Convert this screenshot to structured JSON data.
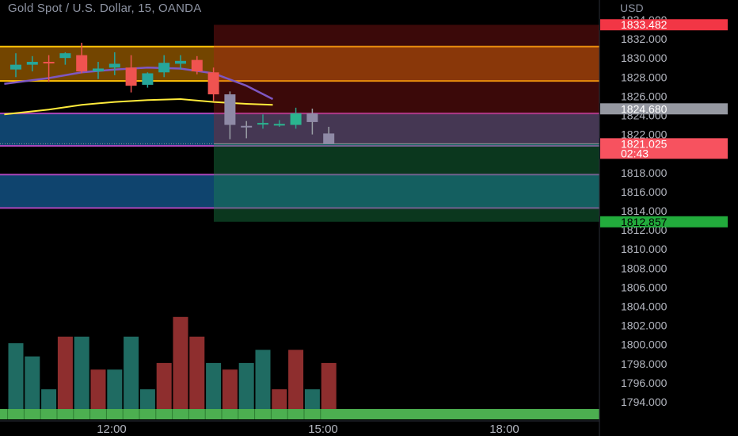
{
  "header": {
    "symbol_title": "Gold Spot / U.S. Dollar, 15, OANDA",
    "currency": "USD"
  },
  "colors": {
    "up": "#26a69a",
    "down": "#ef5350",
    "ma_fast": "#7e57c2",
    "ma_slow": "#ffeb3b",
    "supply_zone": "#ff9800",
    "demand_zone": "#2196f3",
    "position_stop": "#5c0a0a",
    "position_target": "#0a5c2e",
    "volume_strip": "#4caf50"
  },
  "chart_data": {
    "type": "candlestick",
    "instrument": "Gold Spot / U.S. Dollar",
    "timeframe": "15",
    "source": "OANDA",
    "y_unit": "USD",
    "ylim": [
      1792.5,
      1835.0
    ],
    "y_ticks": [
      "1834.000",
      "1832.000",
      "1830.000",
      "1828.000",
      "1826.000",
      "1824.000",
      "1822.000",
      "1820.000",
      "1818.000",
      "1816.000",
      "1814.000",
      "1812.000",
      "1810.000",
      "1808.000",
      "1806.000",
      "1804.000",
      "1802.000",
      "1800.000",
      "1798.000",
      "1796.000",
      "1794.000"
    ],
    "x_ticks": [
      "12:00",
      "15:00",
      "18:00"
    ],
    "candles": [
      {
        "o": 1828.8,
        "h": 1830.5,
        "l": 1828.0,
        "c": 1829.3
      },
      {
        "o": 1829.3,
        "h": 1830.2,
        "l": 1828.6,
        "c": 1829.6
      },
      {
        "o": 1829.6,
        "h": 1830.3,
        "l": 1827.5,
        "c": 1829.5
      },
      {
        "o": 1830.0,
        "h": 1830.6,
        "l": 1829.3,
        "c": 1830.5
      },
      {
        "o": 1830.3,
        "h": 1831.6,
        "l": 1828.4,
        "c": 1828.6
      },
      {
        "o": 1828.6,
        "h": 1829.6,
        "l": 1827.8,
        "c": 1828.9
      },
      {
        "o": 1829.0,
        "h": 1830.6,
        "l": 1828.2,
        "c": 1829.4
      },
      {
        "o": 1829.0,
        "h": 1830.3,
        "l": 1826.4,
        "c": 1827.1
      },
      {
        "o": 1827.2,
        "h": 1828.5,
        "l": 1826.9,
        "c": 1828.4
      },
      {
        "o": 1828.5,
        "h": 1830.3,
        "l": 1828.0,
        "c": 1829.5
      },
      {
        "o": 1829.4,
        "h": 1830.3,
        "l": 1828.8,
        "c": 1829.7
      },
      {
        "o": 1829.8,
        "h": 1830.2,
        "l": 1828.3,
        "c": 1828.6
      },
      {
        "o": 1828.5,
        "h": 1829.0,
        "l": 1825.5,
        "c": 1826.2
      },
      {
        "o": 1826.2,
        "h": 1826.5,
        "l": 1821.5,
        "c": 1823.0
      },
      {
        "o": 1822.9,
        "h": 1823.4,
        "l": 1821.6,
        "c": 1822.8
      },
      {
        "o": 1823.1,
        "h": 1824.1,
        "l": 1822.6,
        "c": 1823.2
      },
      {
        "o": 1823.0,
        "h": 1823.5,
        "l": 1822.8,
        "c": 1823.1
      },
      {
        "o": 1823.0,
        "h": 1824.8,
        "l": 1822.6,
        "c": 1824.2
      },
      {
        "o": 1824.2,
        "h": 1824.7,
        "l": 1822.0,
        "c": 1823.3
      },
      {
        "o": 1822.1,
        "h": 1822.8,
        "l": 1821.0,
        "c": 1821.0
      }
    ],
    "volumes": [
      10,
      8,
      3,
      11,
      11,
      6,
      6,
      11,
      3,
      7,
      14,
      11,
      7,
      6,
      7,
      9,
      3,
      9,
      3,
      7
    ],
    "volume_directions": [
      "up",
      "up",
      "up",
      "down",
      "up",
      "down",
      "up",
      "up",
      "up",
      "down",
      "down",
      "down",
      "up",
      "down",
      "up",
      "up",
      "down",
      "down",
      "up",
      "down"
    ],
    "ma_fast": [
      {
        "i": -0.7,
        "v": 1827.3
      },
      {
        "i": 2,
        "v": 1827.9
      },
      {
        "i": 4,
        "v": 1828.5
      },
      {
        "i": 6,
        "v": 1828.8
      },
      {
        "i": 8,
        "v": 1829.0
      },
      {
        "i": 10,
        "v": 1828.9
      },
      {
        "i": 12,
        "v": 1828.4
      },
      {
        "i": 14,
        "v": 1827.1
      },
      {
        "i": 15.6,
        "v": 1825.7
      }
    ],
    "ma_slow": [
      {
        "i": -0.7,
        "v": 1824.1
      },
      {
        "i": 2,
        "v": 1824.6
      },
      {
        "i": 4,
        "v": 1825.1
      },
      {
        "i": 6,
        "v": 1825.4
      },
      {
        "i": 8,
        "v": 1825.6
      },
      {
        "i": 10,
        "v": 1825.7
      },
      {
        "i": 12,
        "v": 1825.4
      },
      {
        "i": 14,
        "v": 1825.2
      },
      {
        "i": 15.6,
        "v": 1825.1
      }
    ],
    "zones": [
      {
        "name": "supply",
        "top": 1831.2,
        "bottom": 1827.6
      },
      {
        "name": "demand-upper",
        "top": 1824.2,
        "bottom": 1820.8
      },
      {
        "name": "demand-lower",
        "top": 1817.8,
        "bottom": 1814.3
      }
    ],
    "position": {
      "entry": 1821.025,
      "stop": 1833.482,
      "target": 1812.857
    },
    "price_labels": [
      {
        "value": "1833.482",
        "price": 1833.482,
        "kind": "stop"
      },
      {
        "value": "1824.680",
        "price": 1824.68,
        "kind": "mark"
      },
      {
        "value": "1821.025",
        "price": 1821.025,
        "kind": "last",
        "countdown": "02:43"
      },
      {
        "value": "1812.857",
        "price": 1812.857,
        "kind": "target"
      }
    ]
  }
}
